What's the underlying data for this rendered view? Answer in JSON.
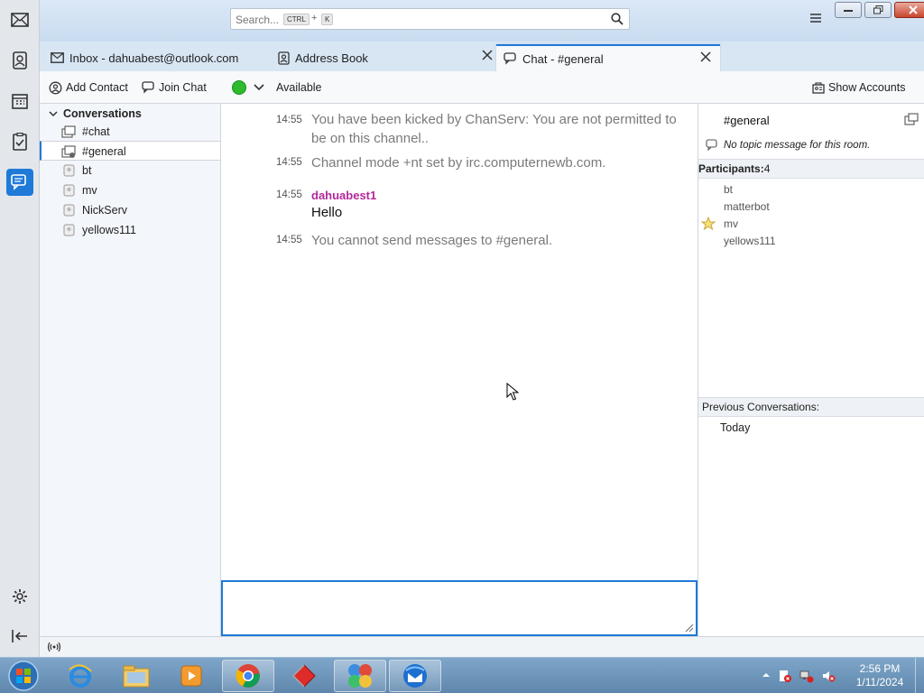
{
  "search": {
    "placeholder": "Search...",
    "kbd1": "CTRL",
    "plus": "+",
    "kbd2": "K"
  },
  "tabs": [
    {
      "label": "Inbox - dahuabest@outlook.com",
      "icon": "mail-icon"
    },
    {
      "label": "Address Book",
      "icon": "address-book-icon"
    },
    {
      "label": "Chat - #general",
      "icon": "chat-icon",
      "selected": true
    }
  ],
  "toolbar": {
    "add_contact": "Add Contact",
    "join_chat": "Join Chat",
    "status": "Available",
    "show_accounts": "Show Accounts"
  },
  "conversations": {
    "header": "Conversations",
    "items": [
      {
        "label": "#chat"
      },
      {
        "label": "#general",
        "selected": true
      },
      {
        "label": "bt"
      },
      {
        "label": "mv"
      },
      {
        "label": "NickServ"
      },
      {
        "label": "yellows111"
      }
    ]
  },
  "messages": [
    {
      "time": "14:55",
      "text": "You have been kicked by ChanServ: You are not permitted to be on this channel.."
    },
    {
      "time": "14:55",
      "text": "Channel mode +nt set by irc.computernewb.com."
    },
    {
      "time": "14:55",
      "nick": "dahuabest1",
      "text": "Hello"
    },
    {
      "time": "14:55",
      "text": "You cannot send messages to #general."
    }
  ],
  "room": {
    "name": "#general",
    "topic": "No topic message for this room.",
    "participants_label": "Participants:",
    "participants_count": "4",
    "participants": [
      "bt",
      "matterbot",
      "mv",
      "yellows111"
    ],
    "previous_label": "Previous Conversations:",
    "previous_today": "Today"
  },
  "clock": {
    "time": "2:56 PM",
    "date": "1/11/2024"
  },
  "colors": {
    "accent": "#1f7ad8",
    "nick": "#b3289c",
    "available": "#2dbb2d"
  }
}
